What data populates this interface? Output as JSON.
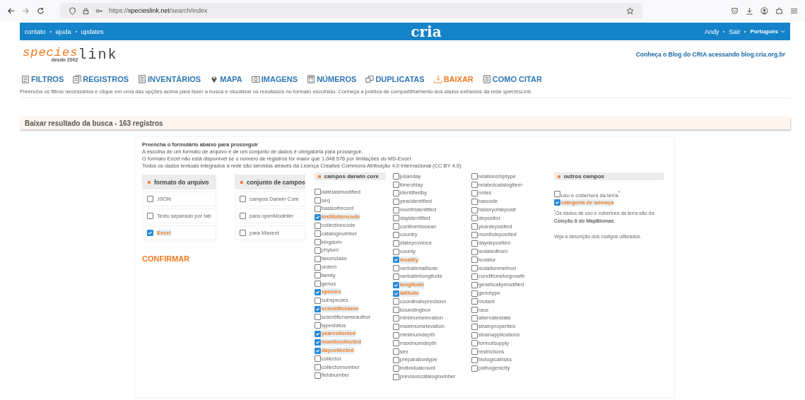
{
  "browser": {
    "url": "https://**specieslink.net**/search/index"
  },
  "topbar": {
    "links": [
      "contato",
      "ajuda",
      "updates"
    ],
    "logo": "cria",
    "user": "Andy",
    "logout": "Sair",
    "language": "Português"
  },
  "header": {
    "logo_species": "species",
    "logo_since": "desde 2002",
    "logo_link": "link",
    "blog": "Conheça o Blog do CRIA acessando blog.cria.org.br"
  },
  "nav": [
    {
      "label": "FILTROS",
      "kind": "filter",
      "selected": false
    },
    {
      "label": "REGISTROS",
      "kind": "records",
      "selected": false
    },
    {
      "label": "INVENTÁRIOS",
      "kind": "list",
      "selected": false
    },
    {
      "label": "MAPA",
      "kind": "pin",
      "selected": false
    },
    {
      "label": "IMAGENS",
      "kind": "camera",
      "selected": false
    },
    {
      "label": "NÚMEROS",
      "kind": "calc",
      "selected": false
    },
    {
      "label": "DUPLICATAS",
      "kind": "copy",
      "selected": false
    },
    {
      "label": "BAIXAR",
      "kind": "download",
      "selected": true
    },
    {
      "label": "COMO CITAR",
      "kind": "list",
      "selected": false
    }
  ],
  "intro": "Preencha os filtros necessários e clique em uma das opções acima para fazer a busca e visualizar os resultados no formato escolhido. Conheça a política de compartilhamento dos dados extraídos da rede *speciesLink*.",
  "section_title": "Baixar resultado da busca - 163 registros",
  "form": {
    "heading": "Preencha o formulário abaixo para prosseguir",
    "lines": [
      "A escolha de um formato de arquivo e de um conjunto de dados é obrigatória para prosseguir.",
      "O formato Excel não está disponível se o número de registros for maior que 1.048.576 por limitações do MS-Excel.",
      "Todos os dados textuais integrados à rede são servidos através da Licença Creative Commons Atribuição 4.0 Internacional (CC BY 4.0)."
    ],
    "file_format": {
      "title": "formato do arquivo",
      "options": [
        {
          "label": "JSON",
          "checked": false
        },
        {
          "label": "Texto separado por tab",
          "checked": false
        },
        {
          "label": "Excel",
          "checked": true
        }
      ]
    },
    "field_set": {
      "title": "conjunto de campos",
      "options": [
        {
          "label": "campos Darwin Core",
          "checked": false
        },
        {
          "label": "para openModeller",
          "checked": false
        },
        {
          "label": "para Maxent",
          "checked": false
        }
      ]
    },
    "confirm": "CONFIRMAR",
    "darwin_core": {
      "title": "campos darwin core",
      "columns": [
        [
          {
            "label": "datelastmodified",
            "checked": false
          },
          {
            "label": "seq",
            "checked": false
          },
          {
            "label": "basisofrecord",
            "checked": false
          },
          {
            "label": "institutioncode",
            "checked": true
          },
          {
            "label": "collectioncode",
            "checked": false
          },
          {
            "label": "catalognumber",
            "checked": false
          },
          {
            "label": "kingdom",
            "checked": false
          },
          {
            "label": "phylum",
            "checked": false
          },
          {
            "label": "taxonclass",
            "checked": false
          },
          {
            "label": "ordem",
            "checked": false
          },
          {
            "label": "family",
            "checked": false
          },
          {
            "label": "genus",
            "checked": false
          },
          {
            "label": "species",
            "checked": true
          },
          {
            "label": "subspecies",
            "checked": false
          },
          {
            "label": "scientificname",
            "checked": true
          },
          {
            "label": "scientificnameauthor",
            "checked": false
          },
          {
            "label": "typestatus",
            "checked": false
          },
          {
            "label": "yearcollected",
            "checked": true
          },
          {
            "label": "monthcollected",
            "checked": true
          },
          {
            "label": "daycollected",
            "checked": true
          },
          {
            "label": "collector",
            "checked": false
          },
          {
            "label": "collectornumber",
            "checked": false
          },
          {
            "label": "fieldnumber",
            "checked": false
          }
        ],
        [
          {
            "label": "julianday",
            "checked": false
          },
          {
            "label": "timeofday",
            "checked": false
          },
          {
            "label": "identifiedby",
            "checked": false
          },
          {
            "label": "yearidentified",
            "checked": false
          },
          {
            "label": "monthidentified",
            "checked": false
          },
          {
            "label": "dayidentified",
            "checked": false
          },
          {
            "label": "continentocean",
            "checked": false
          },
          {
            "label": "country",
            "checked": false
          },
          {
            "label": "stateprovince",
            "checked": false
          },
          {
            "label": "county",
            "checked": false
          },
          {
            "label": "locality",
            "checked": true
          },
          {
            "label": "verbatimlatitude",
            "checked": false
          },
          {
            "label": "verbatimlongitude",
            "checked": false
          },
          {
            "label": "longitude",
            "checked": true
          },
          {
            "label": "latitude",
            "checked": true
          },
          {
            "label": "coordinateprecision",
            "checked": false
          },
          {
            "label": "boundingbox",
            "checked": false
          },
          {
            "label": "minimumelevation",
            "checked": false
          },
          {
            "label": "maximumelevation",
            "checked": false
          },
          {
            "label": "minimumdepth",
            "checked": false
          },
          {
            "label": "maximumdepth",
            "checked": false
          },
          {
            "label": "sex",
            "checked": false
          },
          {
            "label": "preparationtype",
            "checked": false
          },
          {
            "label": "individualcount",
            "checked": false
          },
          {
            "label": "previouscatalognumber",
            "checked": false
          }
        ],
        [
          {
            "label": "relationshiptype",
            "checked": false
          },
          {
            "label": "relatedcatalogitem",
            "checked": false
          },
          {
            "label": "notes",
            "checked": false
          },
          {
            "label": "barcode",
            "checked": false
          },
          {
            "label": "historyofdeposit",
            "checked": false
          },
          {
            "label": "depositor",
            "checked": false
          },
          {
            "label": "yeardeposited",
            "checked": false
          },
          {
            "label": "monthdeposited",
            "checked": false
          },
          {
            "label": "daydeposited",
            "checked": false
          },
          {
            "label": "isolatedfrom",
            "checked": false
          },
          {
            "label": "isolator",
            "checked": false
          },
          {
            "label": "isolationmethod",
            "checked": false
          },
          {
            "label": "conditionsforgrowth",
            "checked": false
          },
          {
            "label": "geneticallymodified",
            "checked": false
          },
          {
            "label": "genotype",
            "checked": false
          },
          {
            "label": "mutant",
            "checked": false
          },
          {
            "label": "race",
            "checked": false
          },
          {
            "label": "alternatestate",
            "checked": false
          },
          {
            "label": "strainproperties",
            "checked": false
          },
          {
            "label": "strainapplications",
            "checked": false
          },
          {
            "label": "formofsupply",
            "checked": false
          },
          {
            "label": "restrictions",
            "checked": false
          },
          {
            "label": "biologicalrisks",
            "checked": false
          },
          {
            "label": "pathogenicity",
            "checked": false
          }
        ]
      ]
    },
    "other_fields": {
      "title": "outros campos",
      "options": [
        {
          "label": "uso e cobertura da terra$^{*}$",
          "checked": false
        },
        {
          "label": "categoria de ameaça",
          "checked": true
        }
      ],
      "note": "$^{*}$Os dados de uso e cobertura da terra são da **Coleção 8 do MapBiomas**.",
      "note_link": "Veja a descrição dos códigos utilizados."
    }
  }
}
